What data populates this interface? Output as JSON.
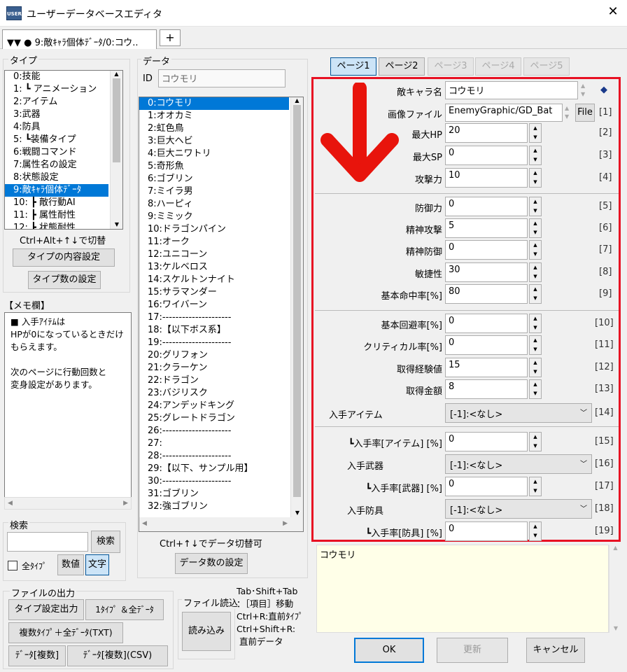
{
  "window": {
    "icon_text": "USER",
    "title": "ユーザーデータベースエディタ",
    "close": "✕"
  },
  "tabs": {
    "active": "▼▼ ● 9:敵ｷｬﾗ個体ﾃﾞｰﾀ/0:コウ..",
    "add": "+"
  },
  "type_panel": {
    "label": "タイプ",
    "items": [
      "0:技能",
      "1: ┗ アニメーション",
      "2:アイテム",
      "3:武器",
      "4:防具",
      "5: ┗装備タイプ",
      "6:戦闘コマンド",
      "7:属性名の設定",
      "8:状態設定",
      "9:敵ｷｬﾗ個体ﾃﾞｰﾀ",
      "10: ┣ 敵行動AI",
      "11: ┣ 属性耐性",
      "12: ┣ 状態耐性"
    ],
    "selected": 9,
    "hint": "Ctrl+Alt+↑↓で切替",
    "content_button": "タイプの内容設定",
    "count_button": "タイプ数の設定"
  },
  "memo": {
    "label": "【メモ欄】",
    "text": "■ 入手ｱｲﾃﾑは\nHPが0になっているときだけ\nもらえます。\n\n次のページに行動回数と\n変身設定があります。"
  },
  "search": {
    "label": "検索",
    "value": "",
    "button": "検索",
    "all_types": "全ﾀｲﾌﾟ",
    "numeric": "数値",
    "text": "文字"
  },
  "file_output": {
    "label": "ファイルの出力",
    "type_settings": "タイプ設定出力",
    "one_type_all": "1ﾀｲﾌﾟ ＆全ﾃﾞｰﾀ",
    "multi_type": "複数ﾀｲﾌﾟ＋全ﾃﾞｰﾀ(TXT)",
    "data_multi": "ﾃﾞｰﾀ[複数]",
    "data_multi_csv": "ﾃﾞｰﾀ[複数](CSV)"
  },
  "file_read": {
    "label": "ファイル読込",
    "button": "読み込み"
  },
  "shortcut_help": "Tab･Shift+Tab\n：［項目］移動\nCtrl+R:直前ﾀｲﾌﾟ\nCtrl+Shift+R:\n 直前データ",
  "data_panel": {
    "label": "データ",
    "id_label": "ID",
    "id_value": "コウモリ",
    "items": [
      "0:コウモリ",
      "1:オオカミ",
      "2:虹色鳥",
      "3:巨大ヘビ",
      "4:巨大ニワトリ",
      "5:奇形魚",
      "6:ゴブリン",
      "7:ミイラ男",
      "8:ハーピィ",
      "9:ミミック",
      "10:ドラゴンパイン",
      "11:オーク",
      "12:ユニコーン",
      "13:ケルベロス",
      "14:スケルトンナイト",
      "15:サラマンダー",
      "16:ワイバーン",
      "17:---------------------",
      "18:【以下ボス系】",
      "19:---------------------",
      "20:グリフォン",
      "21:クラーケン",
      "22:ドラゴン",
      "23:バジリスク",
      "24:アンデッドキング",
      "25:グレートドラゴン",
      "26:---------------------",
      "27:",
      "28:---------------------",
      "29:【以下、サンプル用】",
      "30:---------------------",
      "31:ゴブリン",
      "32:強ゴブリン"
    ],
    "selected": 0,
    "hint": "Ctrl+↑↓でデータ切替可",
    "count_button": "データ数の設定"
  },
  "pages": [
    "ページ1",
    "ページ2",
    "ページ3",
    "ページ4",
    "ページ5"
  ],
  "fields": {
    "enemy_name": {
      "label": "敵キャラ名",
      "value": "コウモリ",
      "marker": "◆"
    },
    "image_file": {
      "label": "画像ファイル",
      "value": "EnemyGraphic/GD_Bat",
      "file_btn": "File",
      "num": "[1]"
    },
    "max_hp": {
      "label": "最大HP",
      "value": "20",
      "num": "[2]"
    },
    "max_sp": {
      "label": "最大SP",
      "value": "0",
      "num": "[3]"
    },
    "attack": {
      "label": "攻撃力",
      "value": "10",
      "num": "[4]"
    },
    "defense": {
      "label": "防御力",
      "value": "0",
      "num": "[5]"
    },
    "mental_atk": {
      "label": "精神攻撃",
      "value": "5",
      "num": "[6]"
    },
    "mental_def": {
      "label": "精神防御",
      "value": "0",
      "num": "[7]"
    },
    "agility": {
      "label": "敏捷性",
      "value": "30",
      "num": "[8]"
    },
    "hit_rate": {
      "label": "基本命中率[%]",
      "value": "80",
      "num": "[9]"
    },
    "evade": {
      "label": "基本回避率[%]",
      "value": "0",
      "num": "[10]"
    },
    "critical": {
      "label": "クリティカル率[%]",
      "value": "0",
      "num": "[11]"
    },
    "exp": {
      "label": "取得経験値",
      "value": "15",
      "num": "[12]"
    },
    "gold": {
      "label": "取得金額",
      "value": "8",
      "num": "[13]"
    },
    "drop_item": {
      "label": "入手アイテム",
      "value": "[-1]:<なし>",
      "num": "[14]"
    },
    "drop_item_rate": {
      "label": "┗入手率[アイテム] [%]",
      "value": "0",
      "num": "[15]"
    },
    "drop_weapon": {
      "label": "入手武器",
      "value": "[-1]:<なし>",
      "num": "[16]"
    },
    "drop_weapon_rate": {
      "label": "┗入手率[武器] [%]",
      "value": "0",
      "num": "[17]"
    },
    "drop_armor": {
      "label": "入手防具",
      "value": "[-1]:<なし>",
      "num": "[18]"
    },
    "drop_armor_rate": {
      "label": "┗入手率[防具] [%]",
      "value": "0",
      "num": "[19]"
    }
  },
  "notes": "コウモリ",
  "buttons": {
    "ok": "OK",
    "update": "更新",
    "cancel": "キャンセル"
  },
  "colors": {
    "accent": "#0078d7",
    "highlight_border": "#e81123",
    "arrow": "#e8140c"
  }
}
